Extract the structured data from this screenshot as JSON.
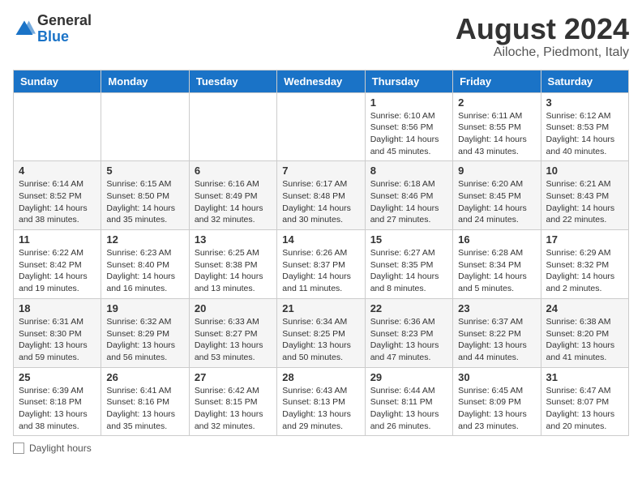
{
  "logo": {
    "general": "General",
    "blue": "Blue"
  },
  "title": "August 2024",
  "subtitle": "Ailoche, Piedmont, Italy",
  "days_of_week": [
    "Sunday",
    "Monday",
    "Tuesday",
    "Wednesday",
    "Thursday",
    "Friday",
    "Saturday"
  ],
  "footer_label": "Daylight hours",
  "weeks": [
    [
      {
        "day": "",
        "info": ""
      },
      {
        "day": "",
        "info": ""
      },
      {
        "day": "",
        "info": ""
      },
      {
        "day": "",
        "info": ""
      },
      {
        "day": "1",
        "info": "Sunrise: 6:10 AM\nSunset: 8:56 PM\nDaylight: 14 hours and 45 minutes."
      },
      {
        "day": "2",
        "info": "Sunrise: 6:11 AM\nSunset: 8:55 PM\nDaylight: 14 hours and 43 minutes."
      },
      {
        "day": "3",
        "info": "Sunrise: 6:12 AM\nSunset: 8:53 PM\nDaylight: 14 hours and 40 minutes."
      }
    ],
    [
      {
        "day": "4",
        "info": "Sunrise: 6:14 AM\nSunset: 8:52 PM\nDaylight: 14 hours and 38 minutes."
      },
      {
        "day": "5",
        "info": "Sunrise: 6:15 AM\nSunset: 8:50 PM\nDaylight: 14 hours and 35 minutes."
      },
      {
        "day": "6",
        "info": "Sunrise: 6:16 AM\nSunset: 8:49 PM\nDaylight: 14 hours and 32 minutes."
      },
      {
        "day": "7",
        "info": "Sunrise: 6:17 AM\nSunset: 8:48 PM\nDaylight: 14 hours and 30 minutes."
      },
      {
        "day": "8",
        "info": "Sunrise: 6:18 AM\nSunset: 8:46 PM\nDaylight: 14 hours and 27 minutes."
      },
      {
        "day": "9",
        "info": "Sunrise: 6:20 AM\nSunset: 8:45 PM\nDaylight: 14 hours and 24 minutes."
      },
      {
        "day": "10",
        "info": "Sunrise: 6:21 AM\nSunset: 8:43 PM\nDaylight: 14 hours and 22 minutes."
      }
    ],
    [
      {
        "day": "11",
        "info": "Sunrise: 6:22 AM\nSunset: 8:42 PM\nDaylight: 14 hours and 19 minutes."
      },
      {
        "day": "12",
        "info": "Sunrise: 6:23 AM\nSunset: 8:40 PM\nDaylight: 14 hours and 16 minutes."
      },
      {
        "day": "13",
        "info": "Sunrise: 6:25 AM\nSunset: 8:38 PM\nDaylight: 14 hours and 13 minutes."
      },
      {
        "day": "14",
        "info": "Sunrise: 6:26 AM\nSunset: 8:37 PM\nDaylight: 14 hours and 11 minutes."
      },
      {
        "day": "15",
        "info": "Sunrise: 6:27 AM\nSunset: 8:35 PM\nDaylight: 14 hours and 8 minutes."
      },
      {
        "day": "16",
        "info": "Sunrise: 6:28 AM\nSunset: 8:34 PM\nDaylight: 14 hours and 5 minutes."
      },
      {
        "day": "17",
        "info": "Sunrise: 6:29 AM\nSunset: 8:32 PM\nDaylight: 14 hours and 2 minutes."
      }
    ],
    [
      {
        "day": "18",
        "info": "Sunrise: 6:31 AM\nSunset: 8:30 PM\nDaylight: 13 hours and 59 minutes."
      },
      {
        "day": "19",
        "info": "Sunrise: 6:32 AM\nSunset: 8:29 PM\nDaylight: 13 hours and 56 minutes."
      },
      {
        "day": "20",
        "info": "Sunrise: 6:33 AM\nSunset: 8:27 PM\nDaylight: 13 hours and 53 minutes."
      },
      {
        "day": "21",
        "info": "Sunrise: 6:34 AM\nSunset: 8:25 PM\nDaylight: 13 hours and 50 minutes."
      },
      {
        "day": "22",
        "info": "Sunrise: 6:36 AM\nSunset: 8:23 PM\nDaylight: 13 hours and 47 minutes."
      },
      {
        "day": "23",
        "info": "Sunrise: 6:37 AM\nSunset: 8:22 PM\nDaylight: 13 hours and 44 minutes."
      },
      {
        "day": "24",
        "info": "Sunrise: 6:38 AM\nSunset: 8:20 PM\nDaylight: 13 hours and 41 minutes."
      }
    ],
    [
      {
        "day": "25",
        "info": "Sunrise: 6:39 AM\nSunset: 8:18 PM\nDaylight: 13 hours and 38 minutes."
      },
      {
        "day": "26",
        "info": "Sunrise: 6:41 AM\nSunset: 8:16 PM\nDaylight: 13 hours and 35 minutes."
      },
      {
        "day": "27",
        "info": "Sunrise: 6:42 AM\nSunset: 8:15 PM\nDaylight: 13 hours and 32 minutes."
      },
      {
        "day": "28",
        "info": "Sunrise: 6:43 AM\nSunset: 8:13 PM\nDaylight: 13 hours and 29 minutes."
      },
      {
        "day": "29",
        "info": "Sunrise: 6:44 AM\nSunset: 8:11 PM\nDaylight: 13 hours and 26 minutes."
      },
      {
        "day": "30",
        "info": "Sunrise: 6:45 AM\nSunset: 8:09 PM\nDaylight: 13 hours and 23 minutes."
      },
      {
        "day": "31",
        "info": "Sunrise: 6:47 AM\nSunset: 8:07 PM\nDaylight: 13 hours and 20 minutes."
      }
    ]
  ]
}
